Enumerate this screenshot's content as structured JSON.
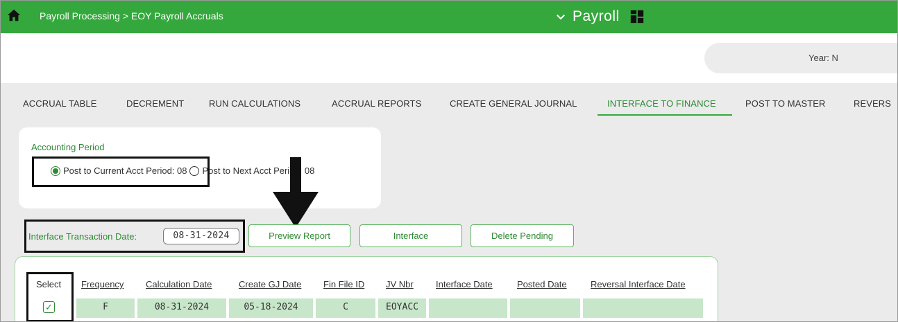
{
  "header": {
    "breadcrumb": "Payroll Processing > EOY Payroll Accruals",
    "app_name": "Payroll"
  },
  "year": {
    "label": "Year: N"
  },
  "tabs": [
    {
      "label": "ACCRUAL TABLE",
      "active": false
    },
    {
      "label": "DECREMENT",
      "active": false
    },
    {
      "label": "RUN CALCULATIONS",
      "active": false
    },
    {
      "label": "ACCRUAL REPORTS",
      "active": false
    },
    {
      "label": "CREATE GENERAL JOURNAL",
      "active": false
    },
    {
      "label": "INTERFACE TO FINANCE",
      "active": true
    },
    {
      "label": "POST TO MASTER",
      "active": false
    },
    {
      "label": "REVERS",
      "active": false
    }
  ],
  "accounting_period": {
    "title": "Accounting Period",
    "options": [
      {
        "label": "Post to Current Acct Period: 08",
        "checked": true
      },
      {
        "label": "Post to Next Acct Period: 08",
        "checked": false
      }
    ]
  },
  "transaction": {
    "label": "Interface Transaction Date:",
    "date": "08-31-2024"
  },
  "buttons": {
    "preview": "Preview Report",
    "interface": "Interface",
    "delete_pending": "Delete Pending"
  },
  "grid": {
    "columns": [
      "Select",
      "Frequency",
      "Calculation Date",
      "Create GJ Date",
      "Fin File ID",
      "JV Nbr",
      "Interface Date",
      "Posted Date",
      "Reversal Interface Date"
    ],
    "rows": [
      {
        "selected": true,
        "check_glyph": "✓",
        "frequency": "F",
        "calculation_date": "08-31-2024",
        "create_gj_date": "05-18-2024",
        "fin_file_id": "C",
        "jv_nbr": "EOYACC",
        "interface_date": "",
        "posted_date": "",
        "reversal_interface_date": ""
      }
    ]
  },
  "colors": {
    "brand_green": "#34a83c",
    "accent_text": "#2f8a36",
    "cell_green": "#c8e6c9"
  }
}
